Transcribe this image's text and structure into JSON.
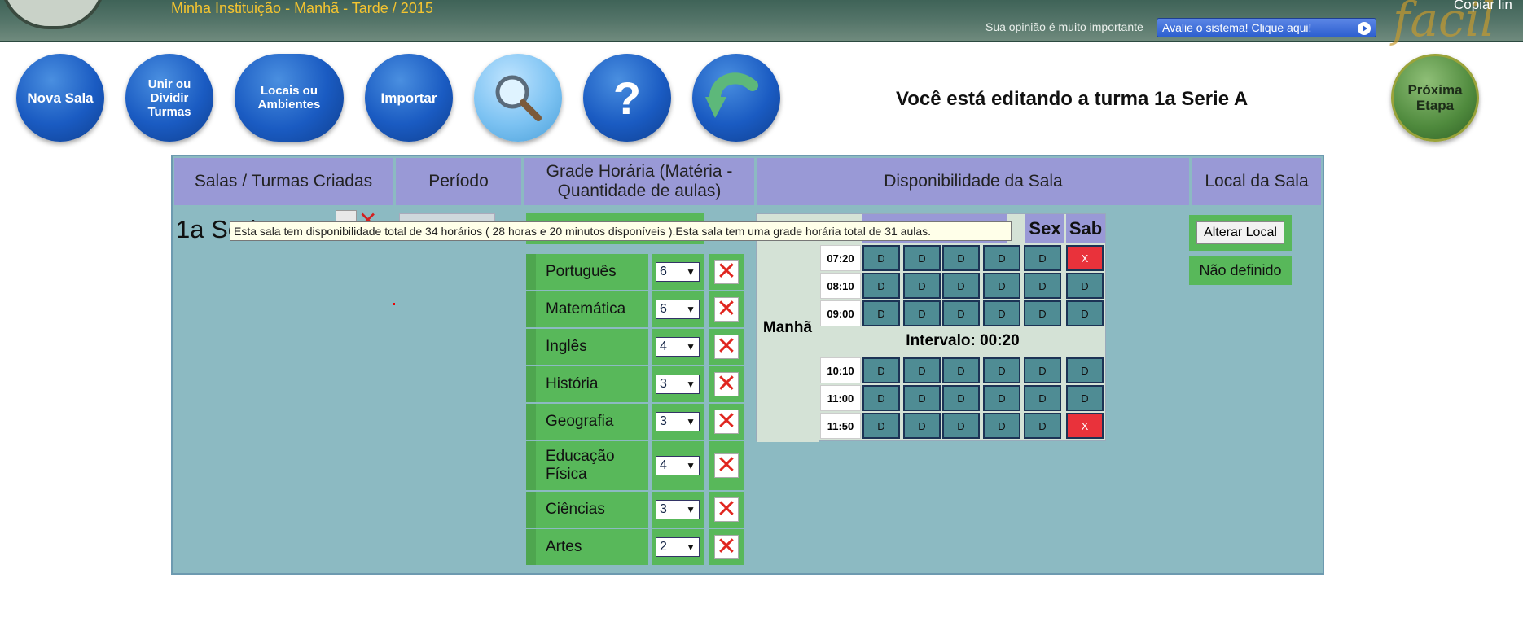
{
  "header": {
    "institution": "Minha Instituição - Manhã - Tarde / 2015",
    "opinion_text": "Sua opinião é muito importante",
    "rate_button": "Avalie o sistema! Clique aqui!",
    "logo_text": "facil",
    "copy_text": "Copiar lin"
  },
  "toolbar": {
    "nova_sala": "Nova Sala",
    "unir_dividir": "Unir ou Dividir Turmas",
    "locais": "Locais ou Ambientes",
    "importar": "Importar",
    "search_icon": "magnifier-icon",
    "help": "?",
    "back_icon": "undo-arrow-icon",
    "proxima": "Próxima Etapa"
  },
  "editing_title": "Você está editando a turma 1a Serie A",
  "table": {
    "headers": [
      "Salas / Turmas Criadas",
      "Período",
      "Grade Horária (Matéria - Quantidade de aulas)",
      "Disponibilidade da Sala",
      "Local da Sala"
    ],
    "turma": "1a Serie A",
    "materias": [
      {
        "name": "Português",
        "qty": "6"
      },
      {
        "name": "Matemática",
        "qty": "6"
      },
      {
        "name": "Inglês",
        "qty": "4"
      },
      {
        "name": "História",
        "qty": "3"
      },
      {
        "name": "Geografia",
        "qty": "3"
      },
      {
        "name": "Educação Física",
        "qty": "4"
      },
      {
        "name": "Ciências",
        "qty": "3"
      },
      {
        "name": "Artes",
        "qty": "2"
      }
    ]
  },
  "availability": {
    "shift": "Manhã",
    "days_visible": [
      "i",
      "Sex",
      "Sab"
    ],
    "times_before": [
      "07:20",
      "08:10",
      "09:00"
    ],
    "intervalo": "Intervalo: 00:20",
    "times_after": [
      "10:10",
      "11:00",
      "11:50"
    ],
    "cell_label": "D",
    "blocked_label": "X"
  },
  "local": {
    "alterar": "Alterar Local",
    "nao_definido": "Não definido"
  },
  "tooltip": "Esta sala tem disponibilidade total de 34 horários ( 28 horas e 20 minutos disponíveis ).Esta sala tem uma grade horária total de 31 aulas."
}
